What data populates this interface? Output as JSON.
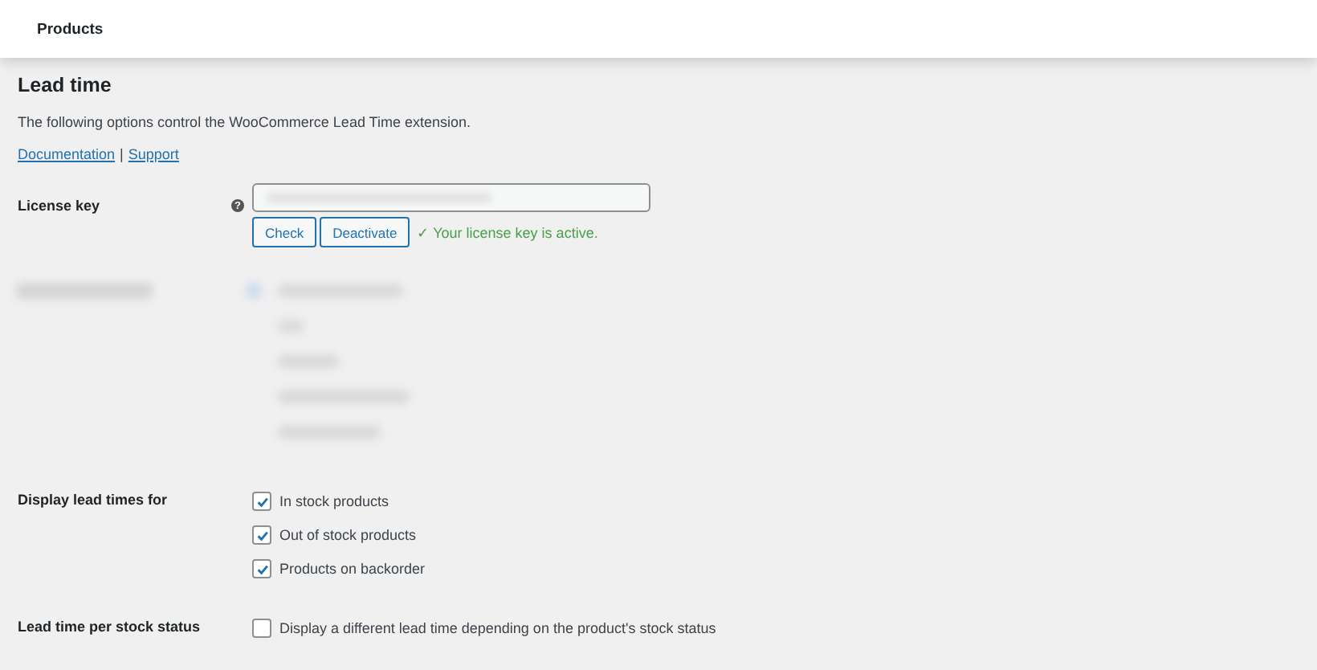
{
  "header": {
    "title": "Products"
  },
  "section": {
    "title": "Lead time",
    "description": "The following options control the WooCommerce Lead Time extension.",
    "links": [
      "Documentation",
      "Support"
    ],
    "separator": "|"
  },
  "license": {
    "label": "License key",
    "help": "?",
    "buttons": [
      "Check",
      "Deactivate"
    ],
    "status": "✓ Your license key is active."
  },
  "display": {
    "label": "Display lead times for",
    "options": [
      {
        "label": "In stock products",
        "checked": true
      },
      {
        "label": "Out of stock products",
        "checked": true
      },
      {
        "label": "Products on backorder",
        "checked": true
      }
    ]
  },
  "per_status": {
    "label": "Lead time per stock status",
    "option": {
      "label": "Display a different lead time depending on the product's stock status",
      "checked": false
    }
  }
}
